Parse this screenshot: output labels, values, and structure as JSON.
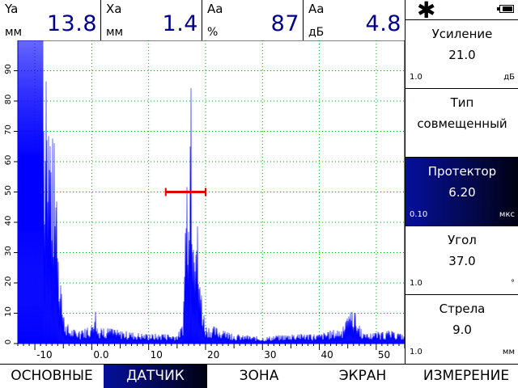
{
  "measurements": [
    {
      "name": "Ya",
      "unit": "мм",
      "value": "13.8"
    },
    {
      "name": "Xa",
      "unit": "мм",
      "value": "1.4"
    },
    {
      "name": "Aa",
      "unit": "%",
      "value": "87"
    },
    {
      "name": "Aa",
      "unit": "дБ",
      "value": "4.8"
    }
  ],
  "status": {
    "mode_icon": "asterisk-icon",
    "battery_icon": "battery-icon"
  },
  "params": [
    {
      "title": "Усиление",
      "value": "21.0",
      "step": "1.0",
      "unit": "дБ",
      "active": false
    },
    {
      "title": "Тип",
      "value": "совмещенный",
      "step": "",
      "unit": "",
      "active": false
    },
    {
      "title": "Протектор",
      "value": "6.20",
      "step": "0.10",
      "unit": "мкс",
      "active": true
    },
    {
      "title": "Угол",
      "value": "37.0",
      "step": "1.0",
      "unit": "°",
      "active": false
    },
    {
      "title": "Стрела",
      "value": "9.0",
      "step": "1.0",
      "unit": "мм",
      "active": false
    }
  ],
  "tabs": [
    {
      "label": "ОСНОВНЫЕ",
      "active": false
    },
    {
      "label": "ДАТЧИК",
      "active": true
    },
    {
      "label": "ЗОНА",
      "active": false
    },
    {
      "label": "ЭКРАН",
      "active": false
    },
    {
      "label": "ИЗМЕРЕНИЕ",
      "active": false
    }
  ],
  "chart_data": {
    "type": "area",
    "x_ticks": [
      "-10",
      "0.0",
      "10",
      "20",
      "30",
      "40",
      "50"
    ],
    "y_ticks": [
      "0",
      "10",
      "20",
      "30",
      "40",
      "50",
      "60",
      "70",
      "80",
      "90"
    ],
    "xlim": [
      -13,
      55
    ],
    "ylim": [
      0,
      100
    ],
    "grid": true,
    "colors": {
      "signal": "#0000ff",
      "gate": "#e00000",
      "grid": "#00a000"
    },
    "signal": [
      [
        -13,
        100
      ],
      [
        -8.5,
        100
      ],
      [
        -8.3,
        90
      ],
      [
        -7.5,
        80
      ],
      [
        -6.5,
        60
      ],
      [
        -6,
        40
      ],
      [
        -5.5,
        20
      ],
      [
        -5,
        10
      ],
      [
        -4,
        5
      ],
      [
        -2,
        4
      ],
      [
        0,
        6
      ],
      [
        0.5,
        14
      ],
      [
        1,
        5
      ],
      [
        3,
        5
      ],
      [
        5,
        4
      ],
      [
        10,
        3
      ],
      [
        15,
        3
      ],
      [
        16,
        6
      ],
      [
        16.5,
        40
      ],
      [
        17,
        83
      ],
      [
        17.3,
        90
      ],
      [
        17.8,
        70
      ],
      [
        18.3,
        50
      ],
      [
        19,
        20
      ],
      [
        20,
        6
      ],
      [
        22,
        5
      ],
      [
        25,
        3
      ],
      [
        30,
        2
      ],
      [
        35,
        3
      ],
      [
        40,
        3
      ],
      [
        44,
        5
      ],
      [
        45.5,
        10
      ],
      [
        46,
        11
      ],
      [
        47,
        6
      ],
      [
        48,
        3
      ],
      [
        52,
        4
      ],
      [
        55,
        3
      ]
    ],
    "gate": {
      "start": 13,
      "end": 20,
      "level": 50
    }
  }
}
